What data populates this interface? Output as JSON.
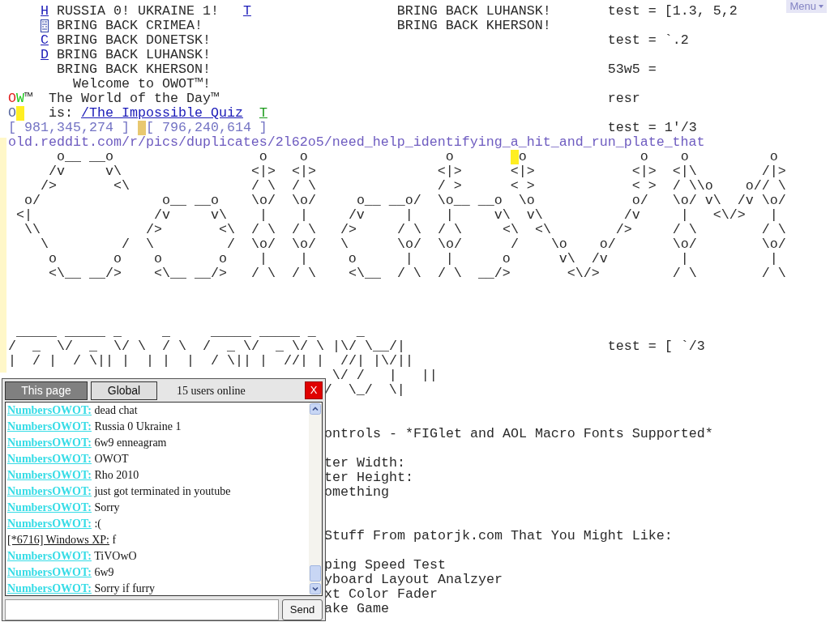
{
  "menu_button": "Menu",
  "world": {
    "top_rows": [
      [
        {
          "text": "     H",
          "kind": "link"
        },
        {
          "text": " RUSSIA 0! UKRAINE 1!",
          "kind": "text"
        },
        {
          "text": "   T",
          "kind": "link"
        },
        {
          "text": "                  BRING BACK LUHANSK!       test = [1.3, 5,2",
          "kind": "text"
        }
      ],
      [
        {
          "text": "     ",
          "kind": "text"
        },
        {
          "kind": "icon"
        },
        {
          "text": " BRING BACK CRIMEA!                        BRING BACK KHERSON!",
          "kind": "text"
        }
      ],
      [
        {
          "text": "     C",
          "kind": "link"
        },
        {
          "text": " BRING BACK DONETSK!                                                 test = `.2",
          "kind": "text"
        }
      ],
      [
        {
          "text": "     D",
          "kind": "link"
        },
        {
          "text": " BRING BACK LUHANSK!",
          "kind": "text"
        }
      ],
      [
        {
          "text": "       BRING BACK KHERSON!                                                 53w5 =",
          "kind": "text"
        }
      ],
      [
        {
          "text": "         Welcome to OWOT™!",
          "kind": "text"
        }
      ],
      [
        {
          "text": " O",
          "kind": "red"
        },
        {
          "text": "W",
          "kind": "green"
        },
        {
          "text": "™  The World of the Day™                                                resr",
          "kind": "text"
        }
      ],
      [
        {
          "text": " O",
          "kind": "blue"
        },
        {
          "kind": "cursor",
          "color": "#ffee22"
        },
        {
          "text": "   is: ",
          "kind": "text"
        },
        {
          "text": "/The_Impossible_Quiz",
          "kind": "link"
        },
        {
          "text": "  T",
          "kind": "greenlink"
        }
      ],
      [
        {
          "text": " [ 981,345,274 ]",
          "kind": "coords"
        },
        {
          "text": " ",
          "kind": "text"
        },
        {
          "kind": "cursor",
          "color": "#e8c870"
        },
        {
          "text": "[ 796,240,614 ]",
          "kind": "coords"
        },
        {
          "text": "                                          test = 1'/3",
          "kind": "text"
        }
      ],
      [
        {
          "text": " old.reddit.com/r/pics/duplicates/2l62o5/need_help_identifying_a_hit_and_run_plate_that",
          "kind": "url"
        }
      ]
    ],
    "art_rows": [
      [
        {
          "text": "       o__ __o                  o    o                 o       ",
          "kind": "text"
        },
        {
          "kind": "cursor",
          "color": "#ffee22"
        },
        {
          "text": "o              o    o          o",
          "kind": "text"
        }
      ],
      [
        {
          "text": "      /v     v\\                <|>  <|>               <|>      <|>            <|>  <|\\        /|>",
          "kind": "text"
        }
      ],
      [
        {
          "text": "     />       <\\               / \\  / \\               / >      < >            < >  / \\\\o    o// \\",
          "kind": "text"
        }
      ],
      [
        {
          "text": "   o/               o__ __o    \\o/  \\o/     o__ __o/  \\o__ __o  \\o            o/   \\o/ v\\  /v \\o/",
          "kind": "text"
        }
      ],
      [
        {
          "text": "  <|               /v     v\\    |    |     /v     |    |     v\\  v\\          /v     |   <\\/>   |",
          "kind": "text"
        }
      ],
      [
        {
          "text": "   \\\\             />       <\\  / \\  / \\   />     / \\  / \\     <\\  <\\        />     / \\        / \\",
          "kind": "text"
        }
      ],
      [
        {
          "text": "     \\         /  \\         /  \\o/  \\o/   \\      \\o/  \\o/      /    \\o    o/       \\o/        \\o/",
          "kind": "text"
        }
      ],
      [
        {
          "text": "      o       o    o       o    |    |     o      |    |      o      v\\  /v         |          |",
          "kind": "text"
        }
      ],
      [
        {
          "text": "      <\\__ __/>    <\\__ __/>   / \\  / \\    <\\__  / \\  / \\  __/>       <\\/>         / \\        / \\",
          "kind": "text"
        }
      ]
    ],
    "banner_rows": [
      [
        {
          "text": "  _____ _____ _     _     _____ _____ _     _",
          "kind": "text"
        }
      ],
      [
        {
          "text": " /  _  \\/  _  \\/ \\  / \\  /  _ \\/  _ \\/ \\ |\\/ \\__/|                         test = [ `/3",
          "kind": "text"
        }
      ],
      [
        {
          "text": " |  / |  / \\|| |  | |  |  / \\|| |  //| |  //| |\\/||",
          "kind": "text"
        }
      ],
      [
        {
          "text": "                                         \\/ /   |   ||",
          "kind": "text"
        }
      ],
      [
        {
          "text": "                                        /  \\_/  \\|",
          "kind": "text"
        }
      ]
    ],
    "page_text": {
      "heading": "ontrols - *FIGlet and AOL Macro Fonts Supported*",
      "settings": [
        "ter Width:",
        "ter Height:",
        "omething"
      ],
      "heading2": "Stuff From patorjk.com That You Might Like:",
      "links": [
        "ping Speed Test",
        "yboard Layout Analzyer",
        "xt Color Fader",
        "ake Game"
      ]
    }
  },
  "chat": {
    "tabs": [
      {
        "label": "This page",
        "selected": true
      },
      {
        "label": "Global",
        "selected": false
      }
    ],
    "users_online": "15 users online",
    "close": "X",
    "messages": [
      {
        "kind": "registered",
        "name": "NumbersOWOT:",
        "text": "dead chat"
      },
      {
        "kind": "registered",
        "name": "NumbersOWOT:",
        "text": "Russia 0 Ukraine 1"
      },
      {
        "kind": "registered",
        "name": "NumbersOWOT:",
        "text": "6w9 enneagram"
      },
      {
        "kind": "registered",
        "name": "NumbersOWOT:",
        "text": "OWOT"
      },
      {
        "kind": "registered",
        "name": "NumbersOWOT:",
        "text": "Rho 2010"
      },
      {
        "kind": "registered",
        "name": "NumbersOWOT:",
        "text": "just got terminated in youtube"
      },
      {
        "kind": "registered",
        "name": "NumbersOWOT:",
        "text": "Sorry"
      },
      {
        "kind": "registered",
        "name": "NumbersOWOT:",
        "text": ":("
      },
      {
        "kind": "anonymous",
        "name": "[*6716] Windows XP:",
        "text": "f"
      },
      {
        "kind": "registered",
        "name": "NumbersOWOT:",
        "text": "TiVOwO"
      },
      {
        "kind": "registered",
        "name": "NumbersOWOT:",
        "text": "6w9"
      },
      {
        "kind": "registered",
        "name": "NumbersOWOT:",
        "text": "Sorry if furry"
      }
    ],
    "send": "Send"
  }
}
